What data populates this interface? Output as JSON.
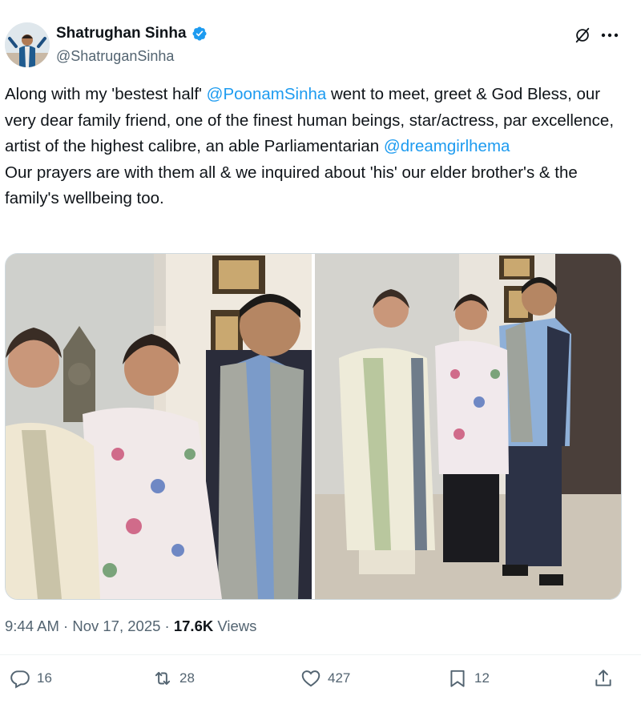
{
  "author": {
    "name": "Shatrughan Sinha",
    "handle": "@ShatruganSinha",
    "verified": true
  },
  "tweet": {
    "text_1": "Along with my 'bestest half' ",
    "mention_1": "@PoonamSinha",
    "text_2": " went to meet, greet & God Bless, our very dear family friend, one of the finest human beings, star/actress, par excellence, artist of the highest calibre, an able Parliamentarian ",
    "mention_2": "@dreamgirlhema",
    "text_3": "\nOur prayers are with them all & we inquired about 'his' our elder brother's & the family's wellbeing too."
  },
  "meta": {
    "time": "9:44 AM",
    "sep1": " · ",
    "date": "Nov 17, 2025",
    "sep2": " · ",
    "views_count": "17.6K",
    "views_label": " Views"
  },
  "actions": {
    "replies": "16",
    "reposts": "28",
    "likes": "427",
    "bookmarks": "12"
  },
  "icons": [
    "verified-badge-icon",
    "grok-icon",
    "more-icon",
    "reply-icon",
    "repost-icon",
    "like-icon",
    "bookmark-icon",
    "share-icon"
  ],
  "colors": {
    "accent": "#1d9bf0",
    "text": "#0f1419",
    "secondary": "#536471"
  }
}
